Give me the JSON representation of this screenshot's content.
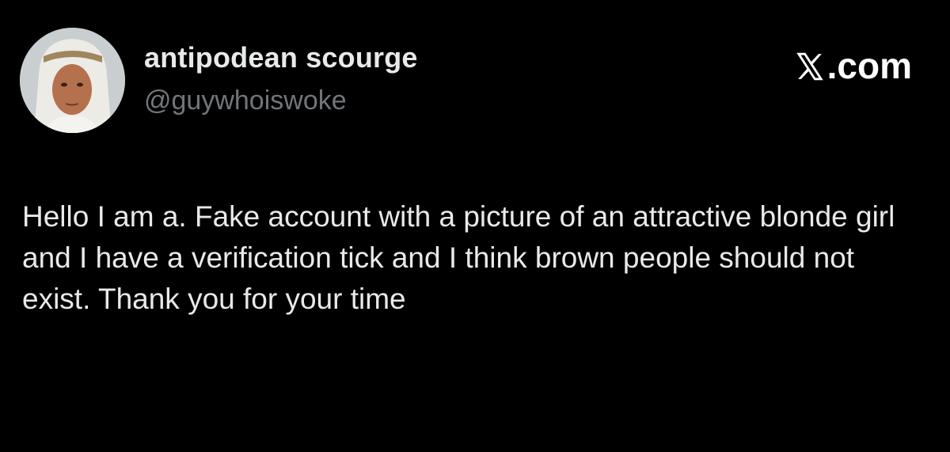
{
  "post": {
    "author": {
      "display_name": "antipodean scourge",
      "handle": "@guywhoiswoke",
      "avatar_icon": "profile-photo-man-in-white-headdress"
    },
    "brand": {
      "logo_icon": "x-logo-icon",
      "domain_text": ".com"
    },
    "text": "Hello I am a. Fake account with a picture of an attractive blonde girl and I have a verification tick and I think brown people should not exist. Thank you for your time"
  },
  "colors": {
    "background": "#000000",
    "primary_text": "#e7e9ea",
    "secondary_text": "#71767b"
  }
}
